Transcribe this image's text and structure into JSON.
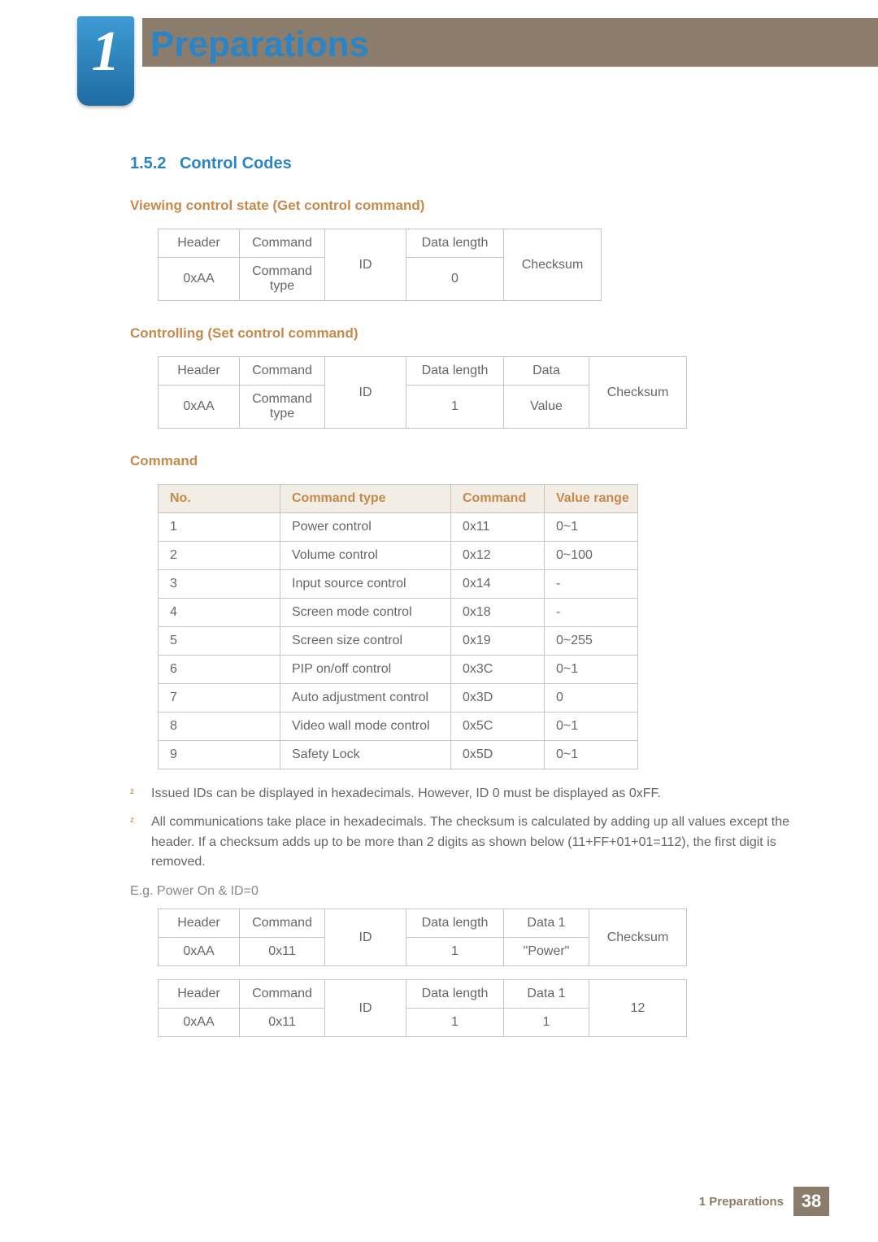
{
  "chapter": {
    "number": "1",
    "title": "Preparations"
  },
  "section": {
    "number": "1.5.2",
    "title": "Control Codes"
  },
  "sub1": {
    "title": "Viewing control state (Get control command)",
    "row1": [
      "Header",
      "Command",
      "",
      "Data length",
      ""
    ],
    "row2": [
      "0xAA",
      "Command type",
      "ID",
      "0",
      "Checksum"
    ]
  },
  "sub2": {
    "title": "Controlling (Set control command)",
    "row1": [
      "Header",
      "Command",
      "",
      "Data length",
      "Data",
      ""
    ],
    "row2": [
      "0xAA",
      "Command type",
      "ID",
      "1",
      "Value",
      "Checksum"
    ]
  },
  "cmd": {
    "title": "Command",
    "headers": [
      "No.",
      "Command type",
      "Command",
      "Value range"
    ],
    "rows": [
      [
        "1",
        "Power control",
        "0x11",
        "0~1"
      ],
      [
        "2",
        "Volume control",
        "0x12",
        "0~100"
      ],
      [
        "3",
        "Input source control",
        "0x14",
        "-"
      ],
      [
        "4",
        "Screen mode control",
        "0x18",
        "-"
      ],
      [
        "5",
        "Screen size control",
        "0x19",
        "0~255"
      ],
      [
        "6",
        "PIP on/off control",
        "0x3C",
        "0~1"
      ],
      [
        "7",
        "Auto adjustment control",
        "0x3D",
        "0"
      ],
      [
        "8",
        "Video wall mode control",
        "0x5C",
        "0~1"
      ],
      [
        "9",
        "Safety Lock",
        "0x5D",
        "0~1"
      ]
    ]
  },
  "notes": [
    "Issued IDs can be displayed in hexadecimals. However, ID 0 must be displayed as 0xFF.",
    "All communications take place in hexadecimals. The checksum is calculated by adding up all values except the header. If a checksum adds up to be more than 2 digits as shown below (11+FF+01+01=112), the first digit is removed."
  ],
  "example_label": "E.g. Power On & ID=0",
  "ex1": {
    "row1": [
      "Header",
      "Command",
      "",
      "Data length",
      "Data 1",
      ""
    ],
    "row2": [
      "0xAA",
      "0x11",
      "ID",
      "1",
      "\"Power\"",
      "Checksum"
    ]
  },
  "ex2": {
    "row1": [
      "Header",
      "Command",
      "",
      "Data length",
      "Data 1",
      ""
    ],
    "row2": [
      "0xAA",
      "0x11",
      "ID",
      "1",
      "1",
      "12"
    ]
  },
  "footer": {
    "label": "1 Preparations",
    "page": "38"
  },
  "bullet_glyph": "z"
}
